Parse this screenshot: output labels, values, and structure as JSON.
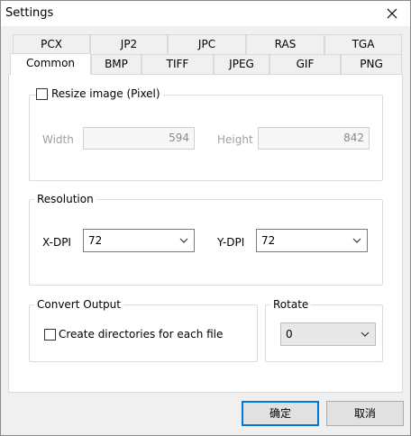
{
  "window": {
    "title": "Settings"
  },
  "tabs": {
    "row_back": [
      "PCX",
      "JP2",
      "JPC",
      "RAS",
      "TGA"
    ],
    "row_front": [
      "Common",
      "BMP",
      "TIFF",
      "JPEG",
      "GIF",
      "PNG"
    ],
    "active": "Common"
  },
  "resize": {
    "checkbox_label": "Resize image (Pixel)",
    "checked": false,
    "width_label": "Width",
    "width_value": "594",
    "height_label": "Height",
    "height_value": "842"
  },
  "resolution": {
    "group_label": "Resolution",
    "xdpi_label": "X-DPI",
    "xdpi_value": "72",
    "ydpi_label": "Y-DPI",
    "ydpi_value": "72"
  },
  "convert_output": {
    "group_label": "Convert Output",
    "checkbox_label": "Create directories for each file",
    "checked": false
  },
  "rotate": {
    "group_label": "Rotate",
    "value": "0"
  },
  "buttons": {
    "ok": "确定",
    "cancel": "取消"
  },
  "colors": {
    "accent": "#0078d7",
    "disabled_text": "#a0a0a0"
  },
  "icons": {
    "close": "close-icon",
    "dropdown": "chevron-down-icon"
  }
}
